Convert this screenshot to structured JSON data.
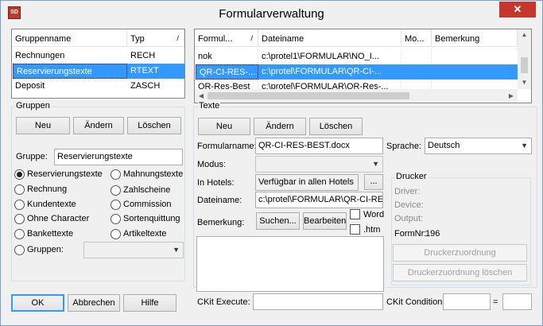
{
  "window": {
    "title": "Formularverwaltung",
    "icon_text": "SD"
  },
  "groups_list": {
    "columns": [
      "Gruppenname",
      "Typ"
    ],
    "sort_indicator": "/",
    "rows": [
      {
        "name": "Rechnungen",
        "typ": "RECH"
      },
      {
        "name": "Reservierungstexte",
        "typ": "RTEXT"
      },
      {
        "name": "Deposit",
        "typ": "ZASCH"
      }
    ],
    "selected_index": 1
  },
  "texts_list": {
    "columns": [
      "Formul...",
      "Dateiname",
      "Mo...",
      "Bemerkung"
    ],
    "sort_indicator": "/",
    "rows": [
      {
        "formular": "nok",
        "dateiname": "c:\\protel1\\FORMULAR\\NO_I...",
        "mo": "",
        "bemerkung": ""
      },
      {
        "formular": "QR-CI-RES-...",
        "dateiname": "c:\\protel\\FORMULAR\\QR-CI-...",
        "mo": "",
        "bemerkung": ""
      },
      {
        "formular": "QR-Res-Best",
        "dateiname": "c:\\protel\\FORMULAR\\QR-Res-...",
        "mo": "",
        "bemerkung": ""
      }
    ],
    "selected_index": 1
  },
  "gruppen_section": {
    "legend": "Gruppen",
    "buttons": {
      "new": "Neu",
      "change": "Ändern",
      "delete": "Löschen"
    },
    "gruppe_label": "Gruppe:",
    "gruppe_value": "Reservierungstexte",
    "radios_left": [
      "Reservierungstexte",
      "Rechnung",
      "Kundentexte",
      "Ohne Character",
      "Bankettexte",
      "Gruppen:"
    ],
    "radios_right": [
      "Mahnungstexte",
      "Zahlscheine",
      "Commission",
      "Sortenquittung",
      "Artikeltexte"
    ],
    "selected_radio": "Reservierungstexte",
    "gruppen_combo_value": ""
  },
  "texte_section": {
    "legend": "Texte",
    "buttons": {
      "new": "Neu",
      "change": "Ändern",
      "delete": "Löschen"
    },
    "formularname_label": "Formularname:",
    "formularname_value": "QR-CI-RES-BEST.docx",
    "sprache_label": "Sprache:",
    "sprache_value": "Deutsch",
    "modus_label": "Modus:",
    "modus_value": "",
    "hotels_label": "In Hotels:",
    "hotels_value": "Verfügbar in allen Hotels",
    "hotels_button": "...",
    "dateiname_label": "Dateiname:",
    "dateiname_value": "c:\\protel\\FORMULAR\\QR-CI-RE",
    "bemerkung_label": "Bemerkung:",
    "search_button": "Suchen...",
    "edit_button": "Bearbeiten",
    "word_label": "Word",
    "htm_label": ".htm",
    "memo_value": ""
  },
  "drucker": {
    "legend": "Drucker",
    "driver_label": "Driver:",
    "device_label": "Device:",
    "output_label": "Output:",
    "formnr_label": "FormNr:",
    "formnr_value": "196",
    "assign_button": "Druckerzuordnung",
    "delete_assign_button": "Druckerzuordnung löschen"
  },
  "footer": {
    "ok": "OK",
    "cancel": "Abbrechen",
    "help": "Hilfe",
    "ckit_execute_label": "CKit Execute:",
    "ckit_execute_value": "",
    "ckit_condition_label": "CKit Condition:",
    "ckit_condition_value": "",
    "equals": "="
  }
}
